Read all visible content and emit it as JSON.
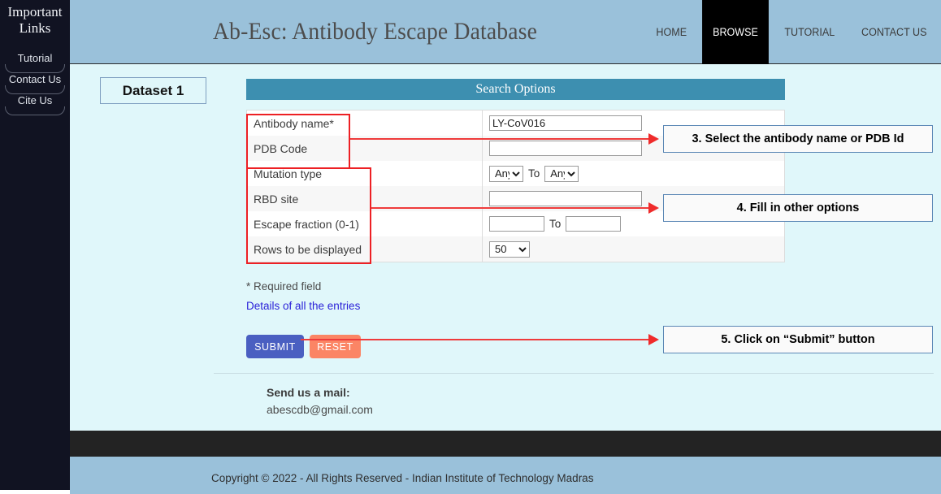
{
  "sidebar": {
    "title": "Important Links",
    "items": [
      {
        "label": "Tutorial"
      },
      {
        "label": "Contact Us"
      },
      {
        "label": "Cite Us"
      }
    ]
  },
  "header": {
    "brand": "Ab-Esc: Antibody Escape Database",
    "nav": [
      {
        "label": "HOME",
        "active": false
      },
      {
        "label": "BROWSE",
        "active": true
      },
      {
        "label": "TUTORIAL",
        "active": false
      },
      {
        "label": "CONTACT US",
        "active": false
      }
    ]
  },
  "page": {
    "dataset_label": "Dataset 1",
    "panel_title": "Search Options",
    "required_note": "* Required field",
    "details_link": "Details of all the entries",
    "form": {
      "rows": [
        {
          "label": "Antibody name*",
          "value": "LY-CoV016",
          "placeholder": ""
        },
        {
          "label": "PDB Code",
          "value": "",
          "placeholder": ""
        },
        {
          "label": "Mutation type",
          "from": "Any",
          "to_label": "To",
          "to": "Any"
        },
        {
          "label": "RBD site",
          "value": "",
          "placeholder": ""
        },
        {
          "label": "Escape fraction (0-1)",
          "value": "",
          "to_label": "To",
          "value2": ""
        },
        {
          "label": "Rows to be displayed",
          "value": "50"
        }
      ],
      "mutation_options": [
        "Any"
      ],
      "rows_options": [
        "50"
      ]
    },
    "buttons": {
      "submit": "SUBMIT",
      "reset": "RESET"
    },
    "mail": {
      "heading": "Send us a mail:",
      "address": "abescdb@gmail.com"
    }
  },
  "annotations": [
    {
      "text": "3. Select the antibody name or PDB Id"
    },
    {
      "text": "4. Fill in other options"
    },
    {
      "text": "5. Click on “Submit” button"
    }
  ],
  "footer": {
    "copyright": "Copyright © 2022 - All Rights Reserved - Indian Institute of Technology Madras"
  },
  "colors": {
    "header_blue": "#9ac1da",
    "page_cyan": "#e0f7fa",
    "panel_blue": "#3d8fb0",
    "sidebar_dark": "#111322",
    "submit_blue": "#4a5fc1",
    "reset_coral": "#fb8565",
    "annotation_red": "#ed2024",
    "link_blue": "#2b22d8"
  }
}
